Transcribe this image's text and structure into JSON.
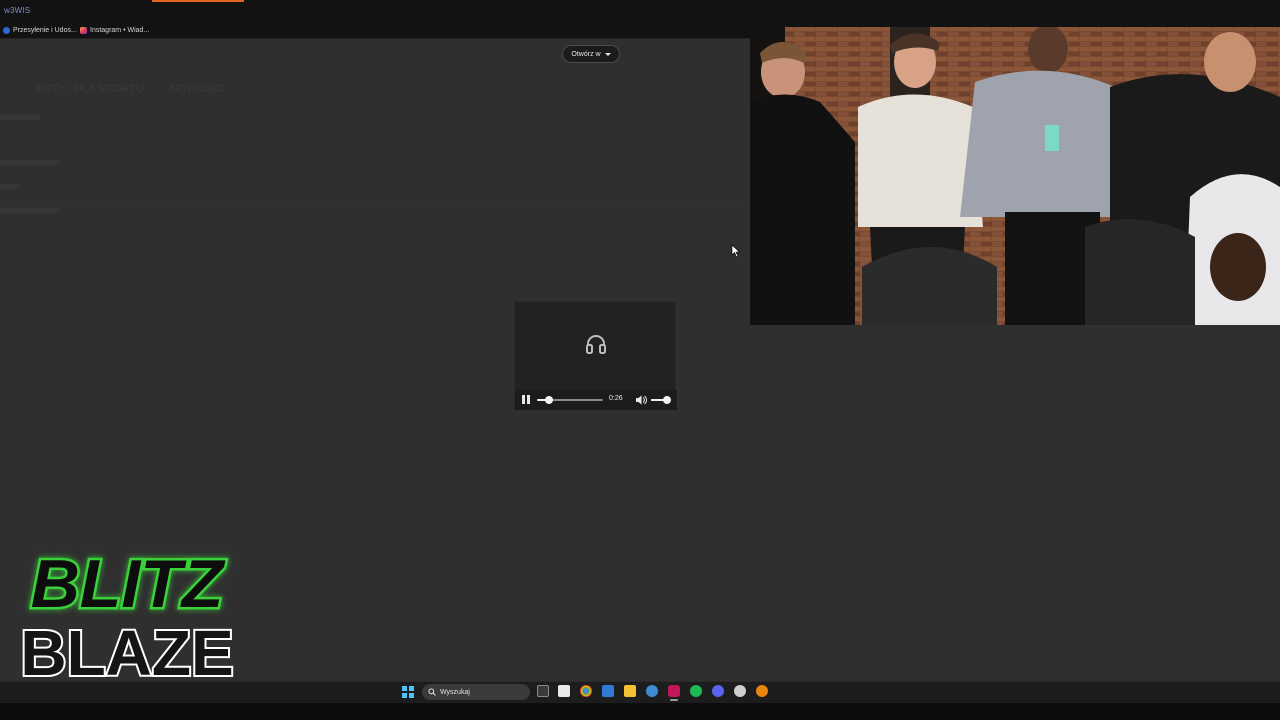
{
  "browser": {
    "url_fragment": "w3WIS",
    "bookmarks": [
      {
        "label": "Przesyłenie i Udos...",
        "icon": "facebook-icon"
      },
      {
        "label": "Instagram • Wiad...",
        "icon": "instagram-icon"
      }
    ]
  },
  "page": {
    "nav": [
      "BUTY I DLA SPORTU",
      "NOWOŚCI"
    ],
    "open_in_label": "Otwórz w"
  },
  "player": {
    "time": "0:26",
    "progress_fraction": 0.18,
    "volume_fraction": 0.8,
    "icon": "headphones-icon"
  },
  "logo": {
    "line1": "BLITZ",
    "line2": "BLAZE"
  },
  "taskbar": {
    "search_placeholder": "Wyszukaj",
    "icons": [
      "windows-start-icon",
      "search-icon",
      "task-view-icon",
      "store-icon",
      "chrome-icon",
      "vscode-icon",
      "file-explorer-icon",
      "app-icon",
      "instagram-app-icon",
      "spotify-icon",
      "discord-icon",
      "steam-icon",
      "firefox-icon"
    ]
  },
  "colors": {
    "accent_tab": "#e0661f",
    "logo_green": "#3bd13a",
    "spotify": "#1db954"
  }
}
